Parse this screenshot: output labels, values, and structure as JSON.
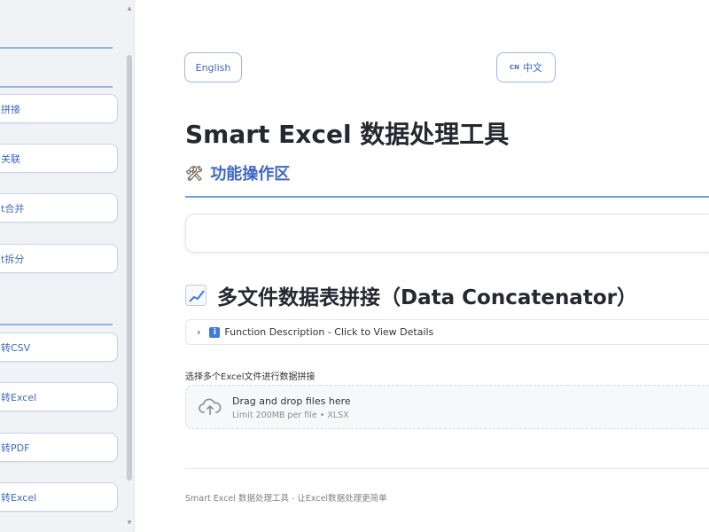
{
  "sidebar": {
    "group1": [
      {
        "label": "拼接"
      },
      {
        "label": "关联"
      },
      {
        "label": "t合并"
      },
      {
        "label": "t拆分"
      }
    ],
    "group2": [
      {
        "label": "转CSV"
      },
      {
        "label": "转Excel"
      },
      {
        "label": "转PDF"
      },
      {
        "label": "转Excel"
      }
    ]
  },
  "header": {
    "english_label": "English",
    "chinese_flag": "CN",
    "chinese_label": "中文"
  },
  "main": {
    "title": "Smart Excel 数据处理工具",
    "subtitle_icon": "🛠",
    "subtitle": "功能操作区",
    "section_title": "多文件数据表拼接（Data Concatenator）",
    "expander_chevron": "›",
    "expander_info_icon": "i",
    "expander_label": "Function Description - Click to View Details",
    "upload_label": "选择多个Excel文件进行数据拼接",
    "dropzone_title": "Drag and drop files here",
    "dropzone_subtitle": "Limit 200MB per file • XLSX",
    "footer": "Smart Excel 数据处理工具 - 让Excel数据处理更简单"
  },
  "colors": {
    "accent": "#3f67c4",
    "divider": "#4a7fd6",
    "sidebar_bg": "#f0f2f6"
  }
}
